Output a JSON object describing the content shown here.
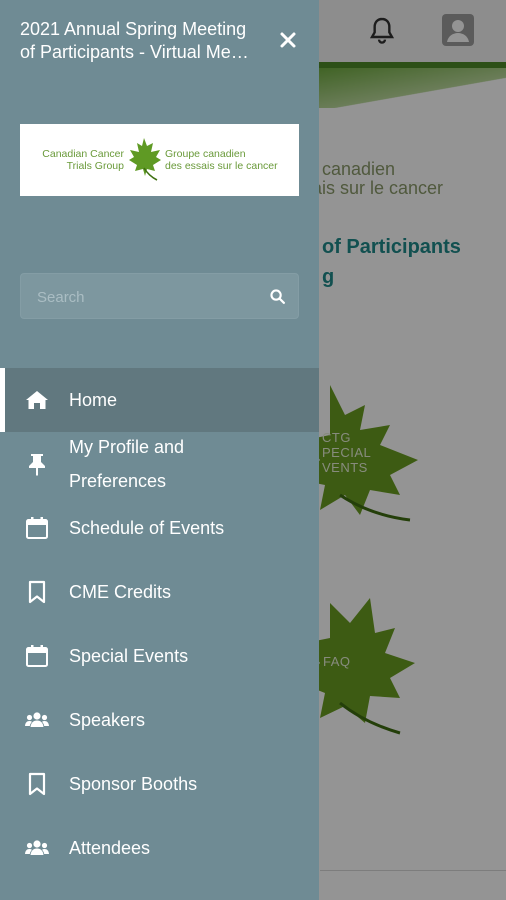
{
  "drawer": {
    "title": "2021 Annual Spring Meeting of Participants - Virtual Me…",
    "title_line1": "2021 Annual Spring Meeting",
    "title_line2": "of Participants - Virtual Me…",
    "logo": {
      "left_line1": "Canadian Cancer",
      "left_line2": "Trials Group",
      "right_line1": "Groupe canadien",
      "right_line2": "des essais sur le cancer"
    },
    "search": {
      "placeholder": "Search"
    },
    "items": [
      {
        "label": "Home",
        "icon": "home-icon",
        "active": true
      },
      {
        "label": "My Profile and Preferences",
        "line1": "My Profile and",
        "line2": "Preferences",
        "icon": "pin-icon"
      },
      {
        "label": "Schedule of Events",
        "icon": "calendar-icon"
      },
      {
        "label": "CME Credits",
        "icon": "bookmark-icon"
      },
      {
        "label": "Special Events",
        "icon": "calendar-icon"
      },
      {
        "label": "Speakers",
        "icon": "users-icon"
      },
      {
        "label": "Sponsor Booths",
        "icon": "bookmark-icon"
      },
      {
        "label": "Attendees",
        "icon": "users-icon"
      }
    ]
  },
  "background": {
    "logo_line1": "canadien",
    "logo_line2": "ais sur le cancer",
    "heading_line1": "of Participants",
    "heading_line2": "g",
    "tile1_line1": "CTG",
    "tile1_line2": "PECIAL",
    "tile1_line3": "VENTS",
    "tile2_label": "FAQ"
  },
  "colors": {
    "drawer_bg": "#6f8b94",
    "active_item_bg": "#61787f",
    "brand_green": "#4e8a28",
    "heading_teal": "#1f8a8a"
  }
}
